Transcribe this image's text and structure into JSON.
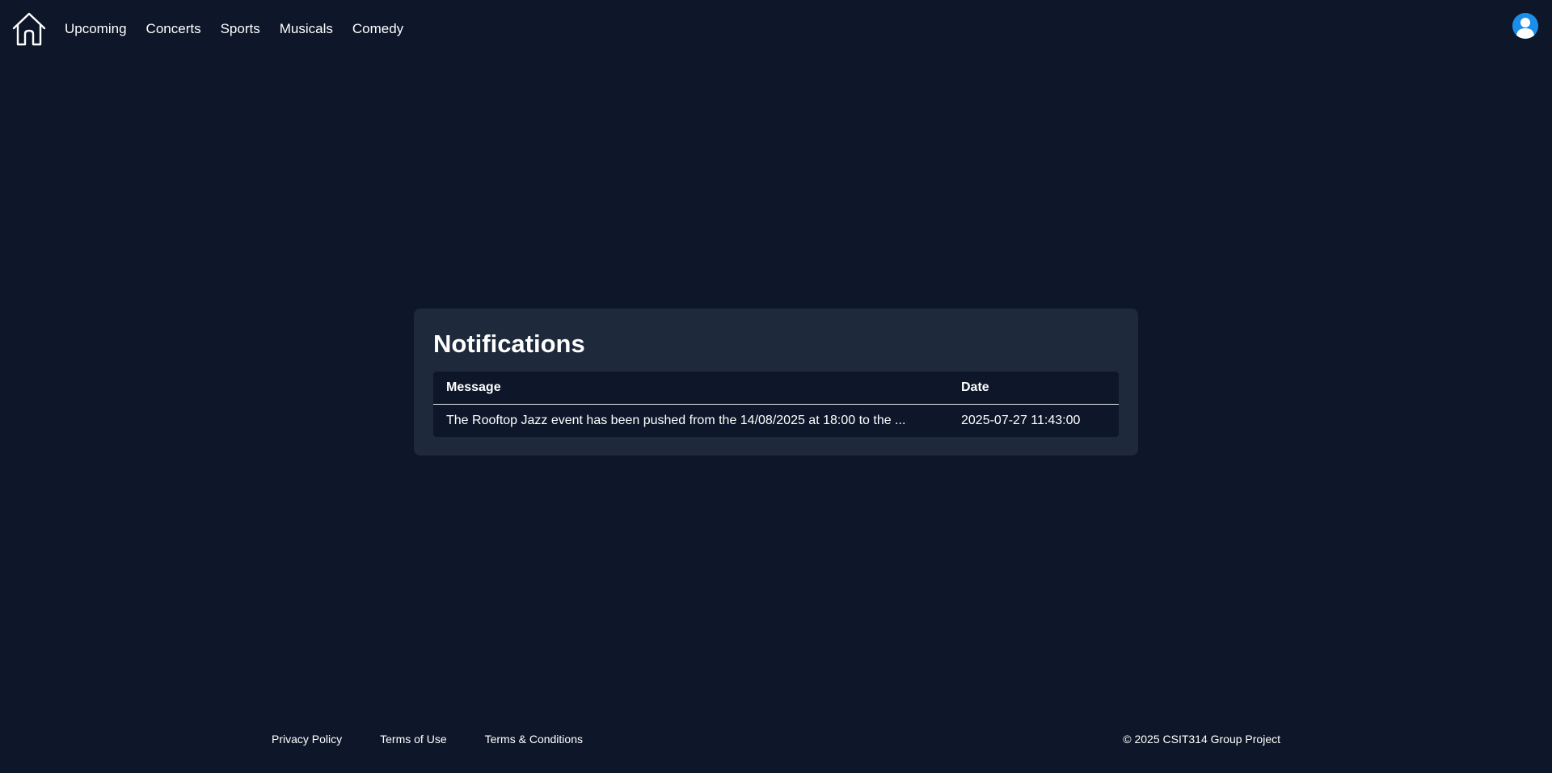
{
  "nav": {
    "home_icon": "home-icon",
    "links": [
      "Upcoming",
      "Concerts",
      "Sports",
      "Musicals",
      "Comedy"
    ],
    "avatar_icon": "user-avatar-icon"
  },
  "notifications": {
    "title": "Notifications",
    "columns": {
      "message": "Message",
      "date": "Date"
    },
    "rows": [
      {
        "message": "The Rooftop Jazz event has been pushed from the 14/08/2025 at 18:00 to the ...",
        "date": "2025-07-27 11:43:00"
      }
    ]
  },
  "footer": {
    "links": [
      "Privacy Policy",
      "Terms of Use",
      "Terms & Conditions"
    ],
    "copyright": "© 2025 CSIT314 Group Project"
  },
  "colors": {
    "background": "#0e172a",
    "card": "#1e293b",
    "avatar": "#1a8ee8",
    "text": "#ffffff"
  }
}
